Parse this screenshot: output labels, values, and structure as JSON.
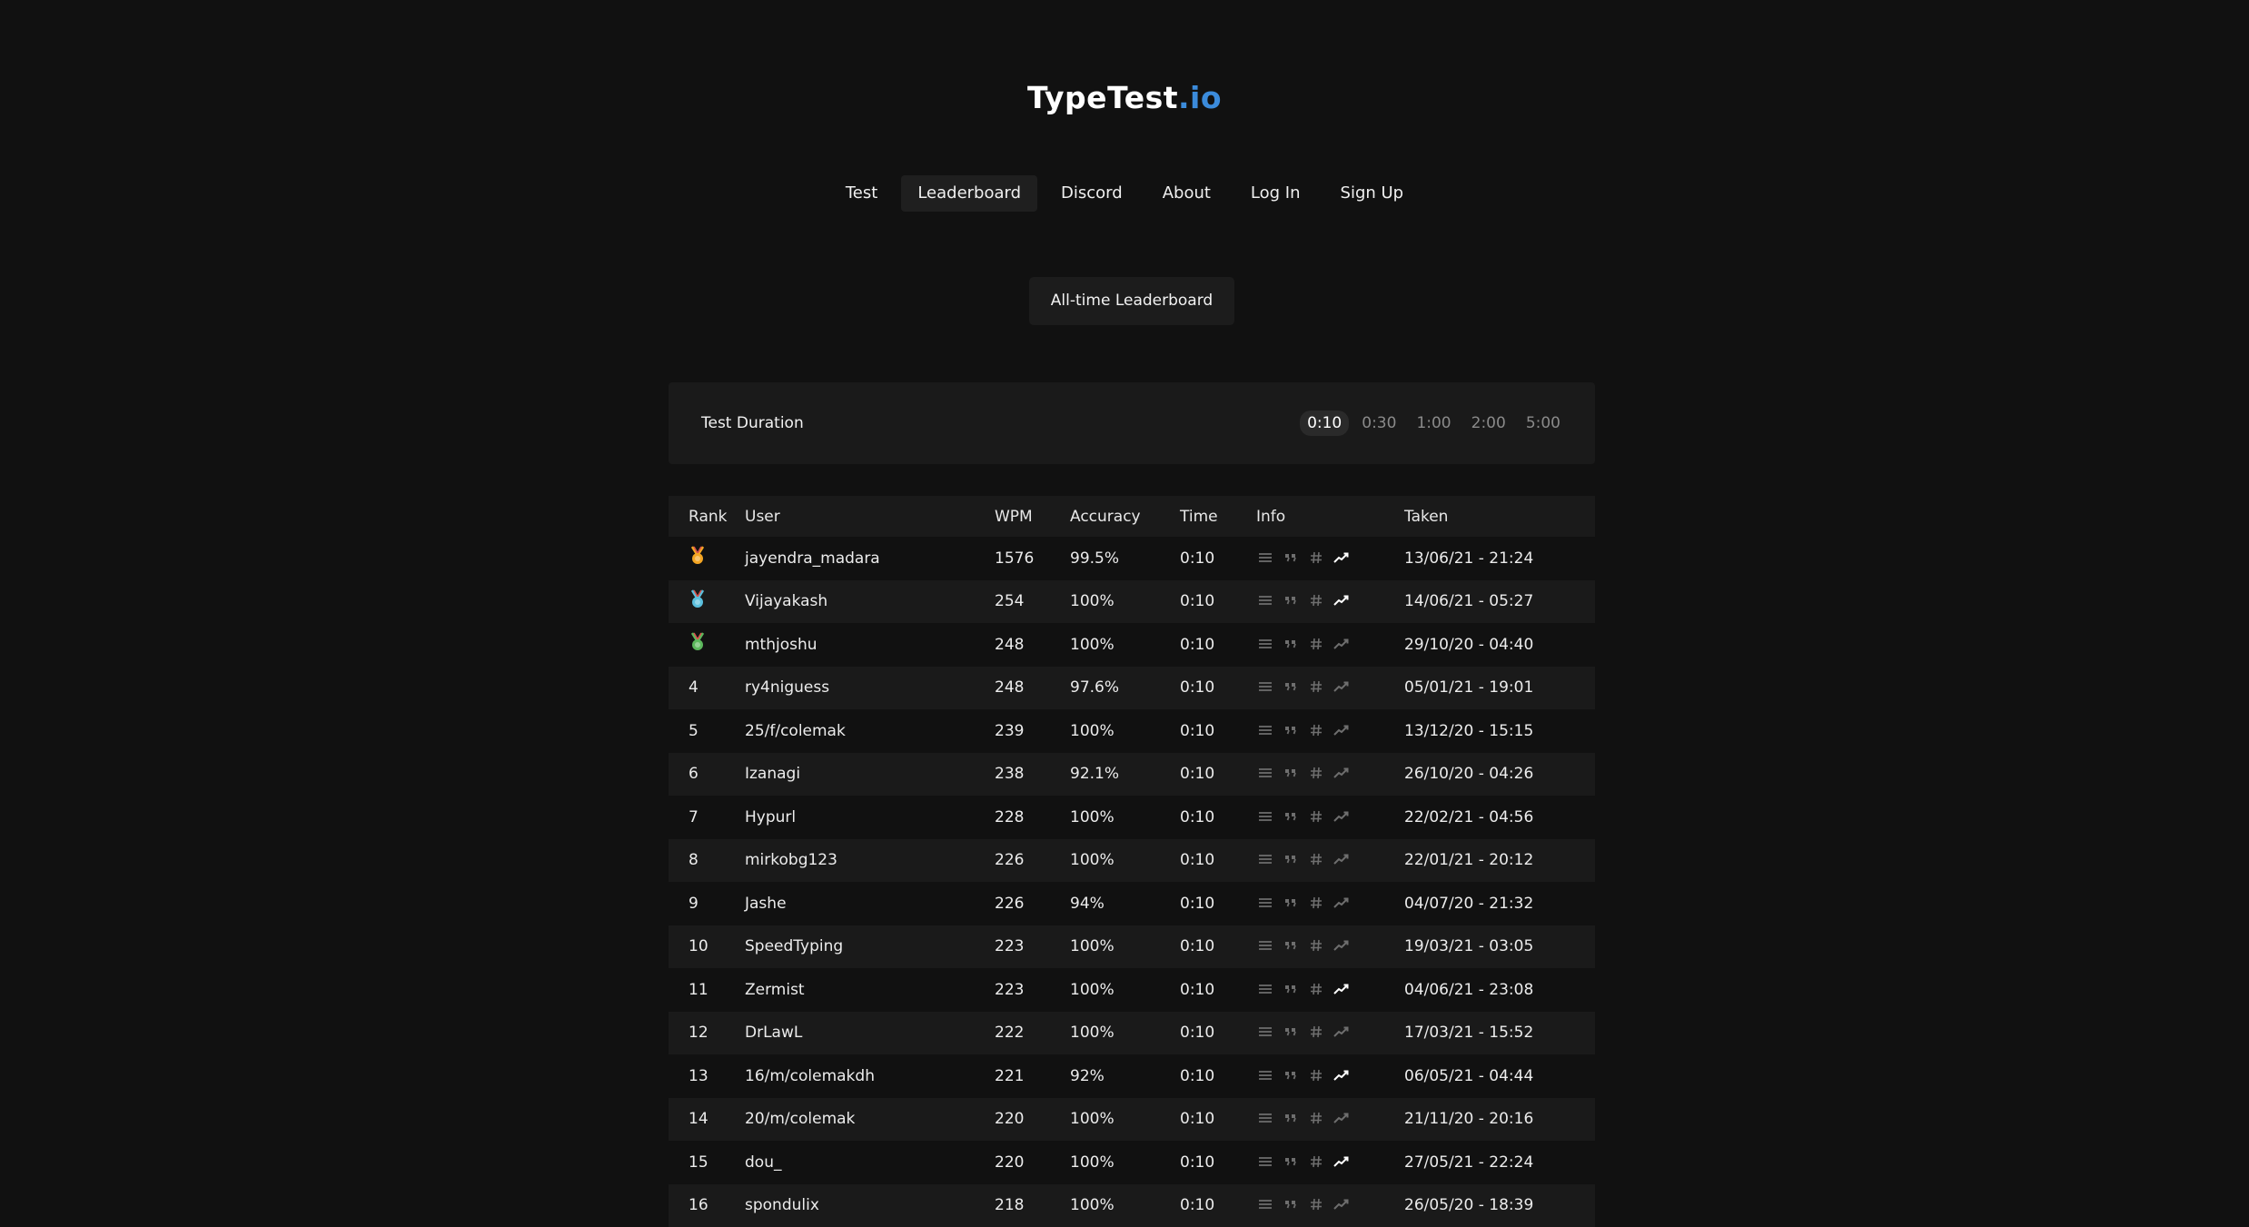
{
  "brand": {
    "name": "TypeTest",
    "tld": ".io",
    "tld_color": "#3b8bdb"
  },
  "nav": [
    {
      "label": "Test",
      "active": false
    },
    {
      "label": "Leaderboard",
      "active": true
    },
    {
      "label": "Discord",
      "active": false
    },
    {
      "label": "About",
      "active": false
    },
    {
      "label": "Log In",
      "active": false
    },
    {
      "label": "Sign Up",
      "active": false
    }
  ],
  "board_button": "All-time Leaderboard",
  "duration": {
    "label": "Test Duration",
    "options": [
      "0:10",
      "0:30",
      "1:00",
      "2:00",
      "5:00"
    ],
    "selected": "0:10"
  },
  "columns": {
    "rank": "Rank",
    "user": "User",
    "wpm": "WPM",
    "accuracy": "Accuracy",
    "time": "Time",
    "info": "Info",
    "taken": "Taken"
  },
  "icons": [
    "lines-icon",
    "quote-icon",
    "hash-icon",
    "trend-icon"
  ],
  "medal_colors": {
    "gold": "#f5a623",
    "silver": "#5bc0de",
    "bronze": "#5cb85c"
  },
  "rows": [
    {
      "rank": "",
      "medal": "gold",
      "user": "jayendra_madara",
      "wpm": "1576",
      "accuracy": "99.5%",
      "time": "0:10",
      "trend": true,
      "taken": "13/06/21 - 21:24"
    },
    {
      "rank": "",
      "medal": "silver",
      "user": "Vijayakash",
      "wpm": "254",
      "accuracy": "100%",
      "time": "0:10",
      "trend": true,
      "taken": "14/06/21 - 05:27"
    },
    {
      "rank": "",
      "medal": "bronze",
      "user": "mthjoshu",
      "wpm": "248",
      "accuracy": "100%",
      "time": "0:10",
      "trend": false,
      "taken": "29/10/20 - 04:40"
    },
    {
      "rank": "4",
      "medal": "",
      "user": "ry4niguess",
      "wpm": "248",
      "accuracy": "97.6%",
      "time": "0:10",
      "trend": false,
      "taken": "05/01/21 - 19:01"
    },
    {
      "rank": "5",
      "medal": "",
      "user": "25/f/colemak",
      "wpm": "239",
      "accuracy": "100%",
      "time": "0:10",
      "trend": false,
      "taken": "13/12/20 - 15:15"
    },
    {
      "rank": "6",
      "medal": "",
      "user": "Izanagi",
      "wpm": "238",
      "accuracy": "92.1%",
      "time": "0:10",
      "trend": false,
      "taken": "26/10/20 - 04:26"
    },
    {
      "rank": "7",
      "medal": "",
      "user": "Hypurl",
      "wpm": "228",
      "accuracy": "100%",
      "time": "0:10",
      "trend": false,
      "taken": "22/02/21 - 04:56"
    },
    {
      "rank": "8",
      "medal": "",
      "user": "mirkobg123",
      "wpm": "226",
      "accuracy": "100%",
      "time": "0:10",
      "trend": false,
      "taken": "22/01/21 - 20:12"
    },
    {
      "rank": "9",
      "medal": "",
      "user": "Jashe",
      "wpm": "226",
      "accuracy": "94%",
      "time": "0:10",
      "trend": false,
      "taken": "04/07/20 - 21:32"
    },
    {
      "rank": "10",
      "medal": "",
      "user": "SpeedTyping",
      "wpm": "223",
      "accuracy": "100%",
      "time": "0:10",
      "trend": false,
      "taken": "19/03/21 - 03:05"
    },
    {
      "rank": "11",
      "medal": "",
      "user": "Zermist",
      "wpm": "223",
      "accuracy": "100%",
      "time": "0:10",
      "trend": true,
      "taken": "04/06/21 - 23:08"
    },
    {
      "rank": "12",
      "medal": "",
      "user": "DrLawL",
      "wpm": "222",
      "accuracy": "100%",
      "time": "0:10",
      "trend": false,
      "taken": "17/03/21 - 15:52"
    },
    {
      "rank": "13",
      "medal": "",
      "user": "16/m/colemakdh",
      "wpm": "221",
      "accuracy": "92%",
      "time": "0:10",
      "trend": true,
      "taken": "06/05/21 - 04:44"
    },
    {
      "rank": "14",
      "medal": "",
      "user": "20/m/colemak",
      "wpm": "220",
      "accuracy": "100%",
      "time": "0:10",
      "trend": false,
      "taken": "21/11/20 - 20:16"
    },
    {
      "rank": "15",
      "medal": "",
      "user": "dou_",
      "wpm": "220",
      "accuracy": "100%",
      "time": "0:10",
      "trend": true,
      "taken": "27/05/21 - 22:24"
    },
    {
      "rank": "16",
      "medal": "",
      "user": "spondulix",
      "wpm": "218",
      "accuracy": "100%",
      "time": "0:10",
      "trend": false,
      "taken": "26/05/20 - 18:39"
    }
  ]
}
